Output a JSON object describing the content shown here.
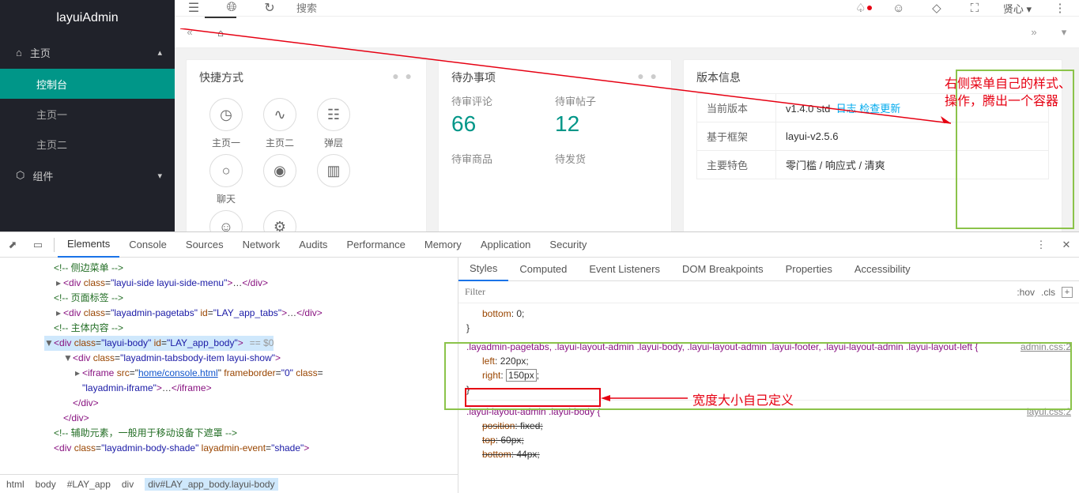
{
  "brand": "layuiAdmin",
  "sidebar": {
    "home": "主页",
    "items": [
      "控制台",
      "主页一",
      "主页二"
    ],
    "component": "组件"
  },
  "topbar": {
    "search_ph": "搜索",
    "user": "贤心"
  },
  "cards": {
    "shortcut": {
      "title": "快捷方式",
      "items": [
        "主页一",
        "主页二",
        "弹层",
        "聊天"
      ]
    },
    "todo": {
      "title": "待办事项",
      "cols": [
        {
          "label": "待审评论",
          "value": "66"
        },
        {
          "label": "待审帖子",
          "value": "12"
        }
      ],
      "bottom": [
        "待审商品",
        "待发货"
      ]
    },
    "version": {
      "title": "版本信息",
      "rows": [
        {
          "k": "当前版本",
          "v": "v1.4.0 std",
          "links": [
            "日志",
            "检查更新"
          ]
        },
        {
          "k": "基于框架",
          "v": "layui-v2.5.6"
        },
        {
          "k": "主要特色",
          "v": "零门槛 / 响应式 / 清爽"
        }
      ]
    }
  },
  "annotation": {
    "right_menu": "右侧菜单自己的样式、\n操作，腾出一个容器",
    "width_define": "宽度大小自己定义"
  },
  "devtools": {
    "tabs": [
      "Elements",
      "Console",
      "Sources",
      "Network",
      "Audits",
      "Performance",
      "Memory",
      "Application",
      "Security"
    ],
    "subtabs": [
      "Styles",
      "Computed",
      "Event Listeners",
      "DOM Breakpoints",
      "Properties",
      "Accessibility"
    ],
    "filter_ph": "Filter",
    "hov": ":hov",
    "cls": ".cls",
    "crumbs": [
      "html",
      "body",
      "#LAY_app",
      "div",
      "div#LAY_app_body.layui-body"
    ],
    "dom": {
      "c_side": "侧边菜单",
      "side": "layui-side layui-side-menu",
      "c_tab": "页面标签",
      "tabs_cls": "layadmin-pagetabs",
      "tabs_id": "LAY_app_tabs",
      "c_body": "主体内容",
      "body_cls": "layui-body",
      "body_id": "LAY_app_body",
      "eq": "== $0",
      "item_cls": "layadmin-tabsbody-item layui-show",
      "iframe_src": "home/console.html",
      "iframe_cls": "layadmin-iframe",
      "c_shade": "辅助元素，一般用于移动设备下遮罩",
      "shade_cls": "layadmin-body-shade",
      "shade_ev": "shade"
    },
    "rule1": {
      "src": "admin.css:2",
      "sel": ".layadmin-pagetabs, .layui-layout-admin .layui-body, .layui-layout-admin .layui-footer, .layui-layout-admin .layui-layout-left {",
      "left": "left",
      "left_v": "220px",
      "right": "right",
      "right_v": "150px"
    },
    "rule0": {
      "bottom": "bottom",
      "bottom_v": "0"
    },
    "rule2": {
      "src": "layui.css:2",
      "sel": ".layui-layout-admin .layui-body {",
      "p1": "position",
      "v1": "fixed",
      "p2": "top",
      "v2": "60px",
      "p3": "bottom",
      "v3": "44px"
    }
  }
}
